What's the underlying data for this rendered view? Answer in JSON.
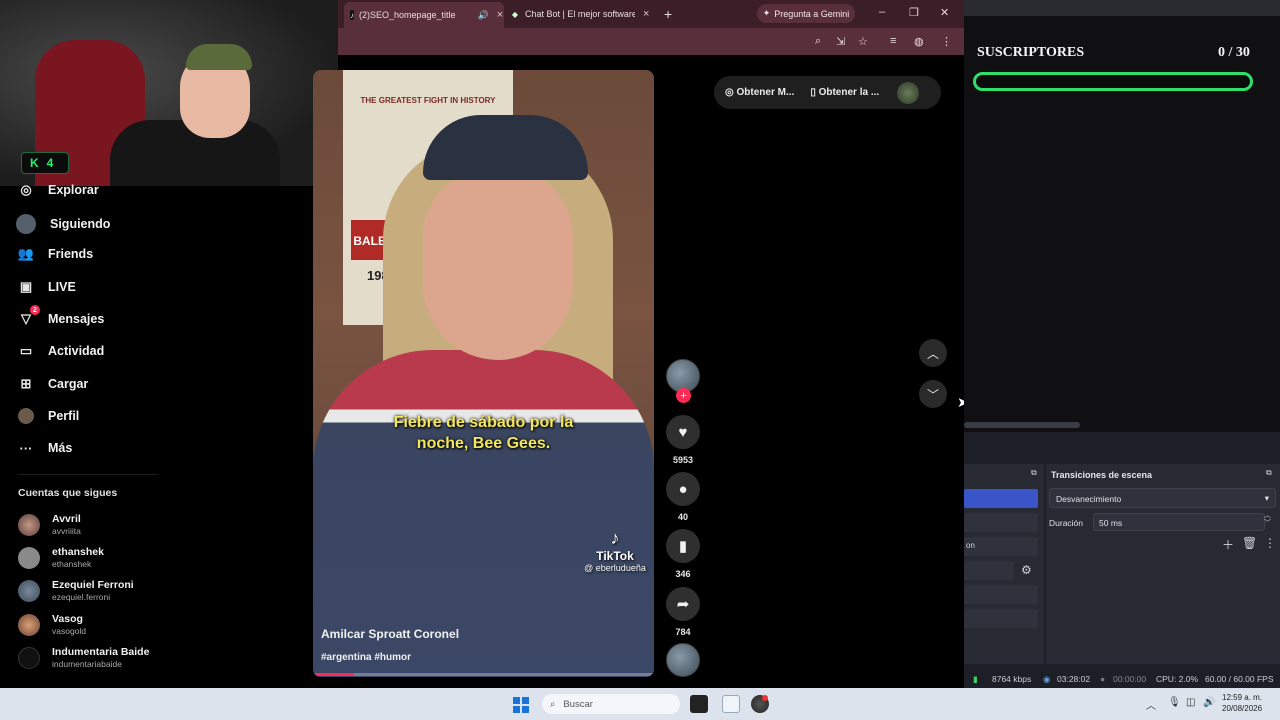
{
  "browser": {
    "tabs": [
      {
        "title": "(2)SEO_homepage_title",
        "favicon": "tiktok-icon"
      },
      {
        "title": "Chat Bot | El mejor software pa",
        "favicon": "chatbot-icon"
      }
    ],
    "gemini_button": "Pregunta a Gemini"
  },
  "webcam": {
    "badge_value": "4"
  },
  "sidebar": {
    "items": [
      {
        "label": "Explorar",
        "icon": "compass-icon"
      },
      {
        "label": "Siguiendo",
        "icon": "avatar"
      },
      {
        "label": "Friends",
        "icon": "friends-icon"
      },
      {
        "label": "LIVE",
        "icon": "live-icon"
      },
      {
        "label": "Mensajes",
        "icon": "messages-icon",
        "badge": "2"
      },
      {
        "label": "Actividad",
        "icon": "activity-icon"
      },
      {
        "label": "Cargar",
        "icon": "upload-icon"
      },
      {
        "label": "Perfil",
        "icon": "profile-avatar"
      },
      {
        "label": "Más",
        "icon": "more-icon"
      }
    ],
    "following_title": "Cuentas que sigues",
    "accounts": [
      {
        "name": "Avvril",
        "user": "avvriiita"
      },
      {
        "name": "ethanshek",
        "user": "ethanshek"
      },
      {
        "name": "Ezequiel Ferroni",
        "user": "ezequiel.ferroni"
      },
      {
        "name": "Vasog",
        "user": "vasogold"
      },
      {
        "name": "Indumentaria Baide",
        "user": "indumentariabaide"
      }
    ]
  },
  "video": {
    "poster_text": "THE GREATEST FIGHT IN HISTORY",
    "poster_balboa": "BALBOA",
    "poster_date": "1982",
    "subtitle_line1": "Fiebre de sábado por la",
    "subtitle_line2": "noche, Bee Gees.",
    "watermark": "TikTok",
    "watermark_handle": "@ eberludueña",
    "author": "Amilcar Sproatt Coronel",
    "tags": "#argentina #humor",
    "progress": 0.12
  },
  "actions": {
    "likes": "5953",
    "comments": "40",
    "saves": "346",
    "shares": "784"
  },
  "get_pill": {
    "item1": "Obtener M...",
    "item2": "Obtener la ..."
  },
  "obs": {
    "subs_title": "SUSCRIPTORES",
    "subs_count": "0 / 30",
    "subs_progress": 0.0,
    "transitions_title": "Transiciones de escena",
    "transition_value": "Desvanecimiento",
    "duration_label": "Duración",
    "duration_value": "50 ms",
    "scene_partial": "on",
    "status": {
      "bitrate": "8764 kbps",
      "rec_time": "03:28:02",
      "live_time": "00:00:00",
      "cpu": "CPU: 2.0%",
      "fps": "60.00 / 60.00 FPS"
    }
  },
  "taskbar": {
    "search_placeholder": "Buscar",
    "time": "12:59 a. m.",
    "date": "20/08/2026"
  },
  "colors": {
    "chrome_frame": "#3b1e27",
    "chrome_toolbar": "#5a2f3c",
    "tiktok_red": "#fe2c55",
    "subs_green": "#2ee06a",
    "subtitle_yellow": "#f4e75a"
  }
}
